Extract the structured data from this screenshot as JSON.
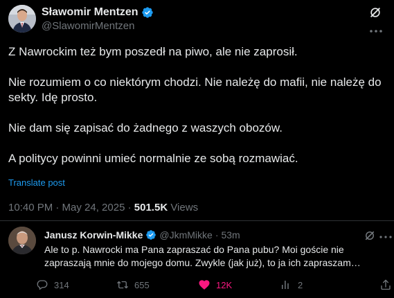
{
  "post": {
    "author": {
      "name": "Sławomir Mentzen",
      "handle": "@SlawomirMentzen",
      "verified": true
    },
    "paragraphs": [
      "Z Nawrockim też bym poszedł na piwo, ale nie zaprosił.",
      "Nie rozumiem o co niektórym chodzi. Nie należę do mafii, nie należę do sekty. Idę prosto.",
      "Nie dam się zapisać do żadnego z waszych obozów.",
      "A politycy powinni umieć normalnie ze sobą rozmawiać."
    ],
    "translate_label": "Translate post",
    "timestamp": "10:40 PM · May 24, 2025",
    "separator": "·",
    "views_count": "501.5K",
    "views_label": "Views"
  },
  "reply": {
    "author_name": "Janusz Korwin-Mikke",
    "verified": true,
    "handle": "@JkmMikke",
    "dot": "·",
    "time": "53m",
    "text": "Ale to p. Nawrocki ma Pana zapraszać do Pana pubu? Moi goście nie zapraszają mnie do mojego domu. Zwykle (jak już), to ja ich zapraszam…",
    "stats": {
      "replies": "314",
      "reposts": "655",
      "likes": "12K",
      "views": "2"
    },
    "liked": true
  },
  "icons": {
    "verified": "verified-badge-icon",
    "grok": "grok-icon",
    "more": "more-icon",
    "reply": "comment-icon",
    "repost": "repost-icon",
    "like": "heart-icon",
    "views": "analytics-icon",
    "share": "share-icon"
  },
  "colors": {
    "background": "#000000",
    "text": "#e7e9ea",
    "secondary": "#71767b",
    "accent": "#1d9bf0",
    "like": "#f91880",
    "divider": "#2f3336"
  }
}
